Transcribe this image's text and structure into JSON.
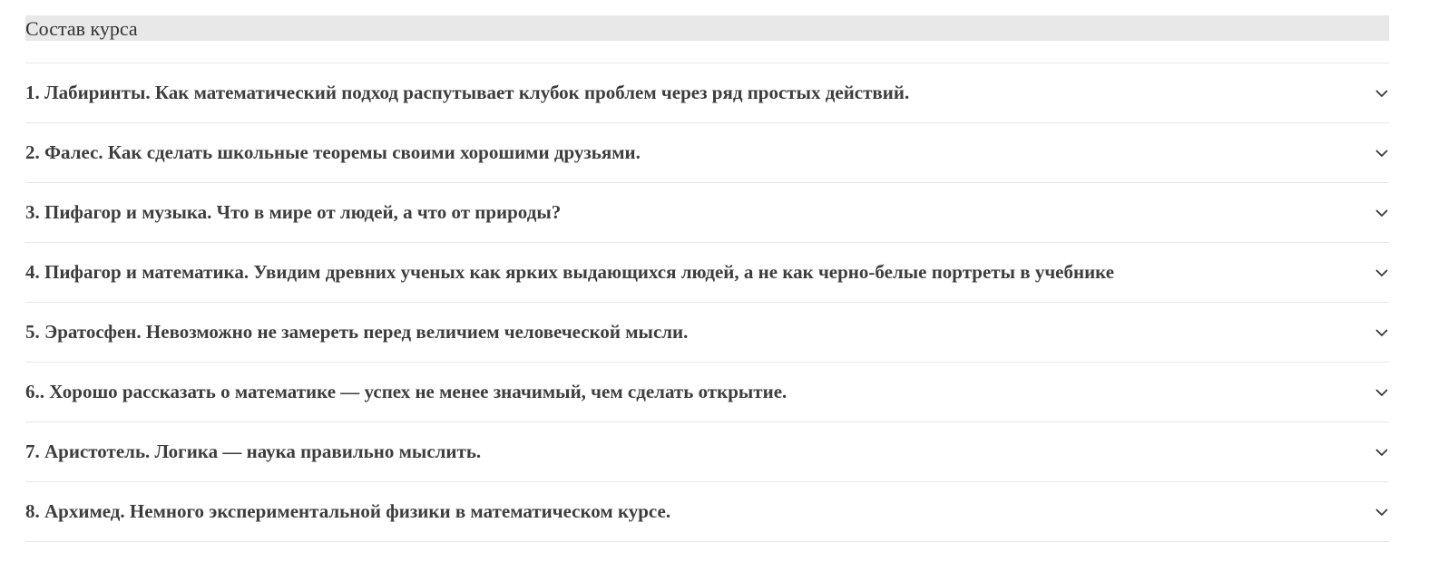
{
  "section": {
    "title": "Состав курса"
  },
  "lessons": [
    {
      "label": "1. Лабиринты. Как математический подход распутывает клубок проблем через ряд простых действий."
    },
    {
      "label": "2. Фалес. Как сделать школьные теоремы своими хорошими друзьями."
    },
    {
      "label": "3. Пифагор и музыка. Что в мире от людей, а что от природы?"
    },
    {
      "label": "4. Пифагор и математика. Увидим древних ученых как ярких выдающихся людей, а не как черно-белые портреты в учебнике"
    },
    {
      "label": "5. Эратосфен. Невозможно не замереть перед величием человеческой мысли."
    },
    {
      "label": "6.. Хорошо рассказать о математике — успех не менее значимый, чем сделать открытие."
    },
    {
      "label": "7. Аристотель. Логика — наука правильно мыслить."
    },
    {
      "label": "8. Архимед. Немного экспериментальной физики в математическом курсе."
    }
  ],
  "icons": {
    "expand": "chevron-down-icon"
  },
  "colors": {
    "header_bg": "#e8e8e8",
    "divider": "#e6e6e6",
    "text": "#3d3d3d"
  }
}
